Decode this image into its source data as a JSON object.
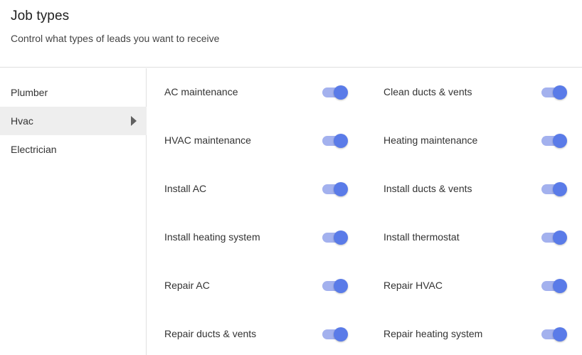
{
  "header": {
    "title": "Job types",
    "subtitle": "Control what types of leads you want to receive"
  },
  "sidebar": {
    "items": [
      {
        "label": "Plumber",
        "active": false
      },
      {
        "label": "Hvac",
        "active": true
      },
      {
        "label": "Electrician",
        "active": false
      }
    ]
  },
  "jobs": {
    "left": [
      {
        "label": "AC maintenance",
        "enabled": true
      },
      {
        "label": "HVAC maintenance",
        "enabled": true
      },
      {
        "label": "Install AC",
        "enabled": true
      },
      {
        "label": "Install heating system",
        "enabled": true
      },
      {
        "label": "Repair AC",
        "enabled": true
      },
      {
        "label": "Repair ducts & vents",
        "enabled": true
      }
    ],
    "right": [
      {
        "label": "Clean ducts & vents",
        "enabled": true
      },
      {
        "label": "Heating maintenance",
        "enabled": true
      },
      {
        "label": "Install ducts & vents",
        "enabled": true
      },
      {
        "label": "Install thermostat",
        "enabled": true
      },
      {
        "label": "Repair HVAC",
        "enabled": true
      },
      {
        "label": "Repair heating system",
        "enabled": true
      }
    ]
  },
  "colors": {
    "toggle_track": "#a3b1ee",
    "toggle_thumb": "#5a7be8",
    "active_row_bg": "#eeeeee"
  }
}
